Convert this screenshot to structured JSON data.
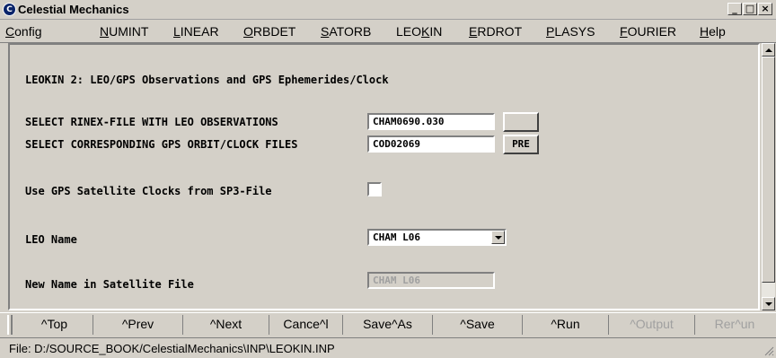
{
  "window": {
    "title": "Celestial Mechanics",
    "controls": {
      "minimize": "_",
      "maximize": "□",
      "close": "×"
    }
  },
  "menu": [
    {
      "label": "Config",
      "underline": "C",
      "rest": "onfig"
    },
    {
      "label": "NUMINT",
      "underline": "N",
      "rest": "UMINT"
    },
    {
      "label": "LINEAR",
      "underline": "L",
      "rest": "INEAR"
    },
    {
      "label": "ORBDET",
      "underline": "O",
      "rest": "RBDET"
    },
    {
      "label": "SATORB",
      "underline": "S",
      "rest": "ATORB"
    },
    {
      "label": "LEOKIN",
      "pre": "LEO",
      "underline": "K",
      "rest": "IN"
    },
    {
      "label": "ERDROT",
      "underline": "E",
      "rest": "RDROT"
    },
    {
      "label": "PLASYS",
      "underline": "P",
      "rest": "LASYS"
    },
    {
      "label": "FOURIER",
      "underline": "F",
      "rest": "OURIER"
    },
    {
      "label": "Help",
      "underline": "H",
      "rest": "elp"
    }
  ],
  "panel": {
    "title": "LEOKIN 2: LEO/GPS Observations and GPS Ephemerides/Clock",
    "rinex_label": "SELECT RINEX-FILE WITH LEO OBSERVATIONS",
    "rinex_value": "CHAM0690.030",
    "rinex_button": "",
    "orbit_label": "SELECT CORRESPONDING GPS ORBIT/CLOCK FILES",
    "orbit_value": "COD02069",
    "orbit_button": "PRE",
    "clock_label": "Use GPS Satellite Clocks from SP3-File",
    "clock_checked": false,
    "leo_name_label": "LEO Name",
    "leo_name_value": "CHAM L06",
    "new_name_label": "New Name in Satellite File",
    "new_name_value": "CHAM L06"
  },
  "commands": [
    {
      "label": "^Top",
      "enabled": true
    },
    {
      "label": "^Prev",
      "enabled": true
    },
    {
      "label": "^Next",
      "enabled": true
    },
    {
      "label": "Cance^l",
      "enabled": true
    },
    {
      "label": "Save^As",
      "enabled": true
    },
    {
      "label": "^Save",
      "enabled": true
    },
    {
      "label": "^Run",
      "enabled": true
    },
    {
      "label": "^Output",
      "enabled": false
    },
    {
      "label": "Rer^un",
      "enabled": false
    }
  ],
  "status": {
    "text": "File: D:/SOURCE_BOOK/CelestialMechanics\\INP\\LEOKIN.INP"
  },
  "colors": {
    "face": "#d4d0c8",
    "disabled_text": "#a0a0a0"
  }
}
